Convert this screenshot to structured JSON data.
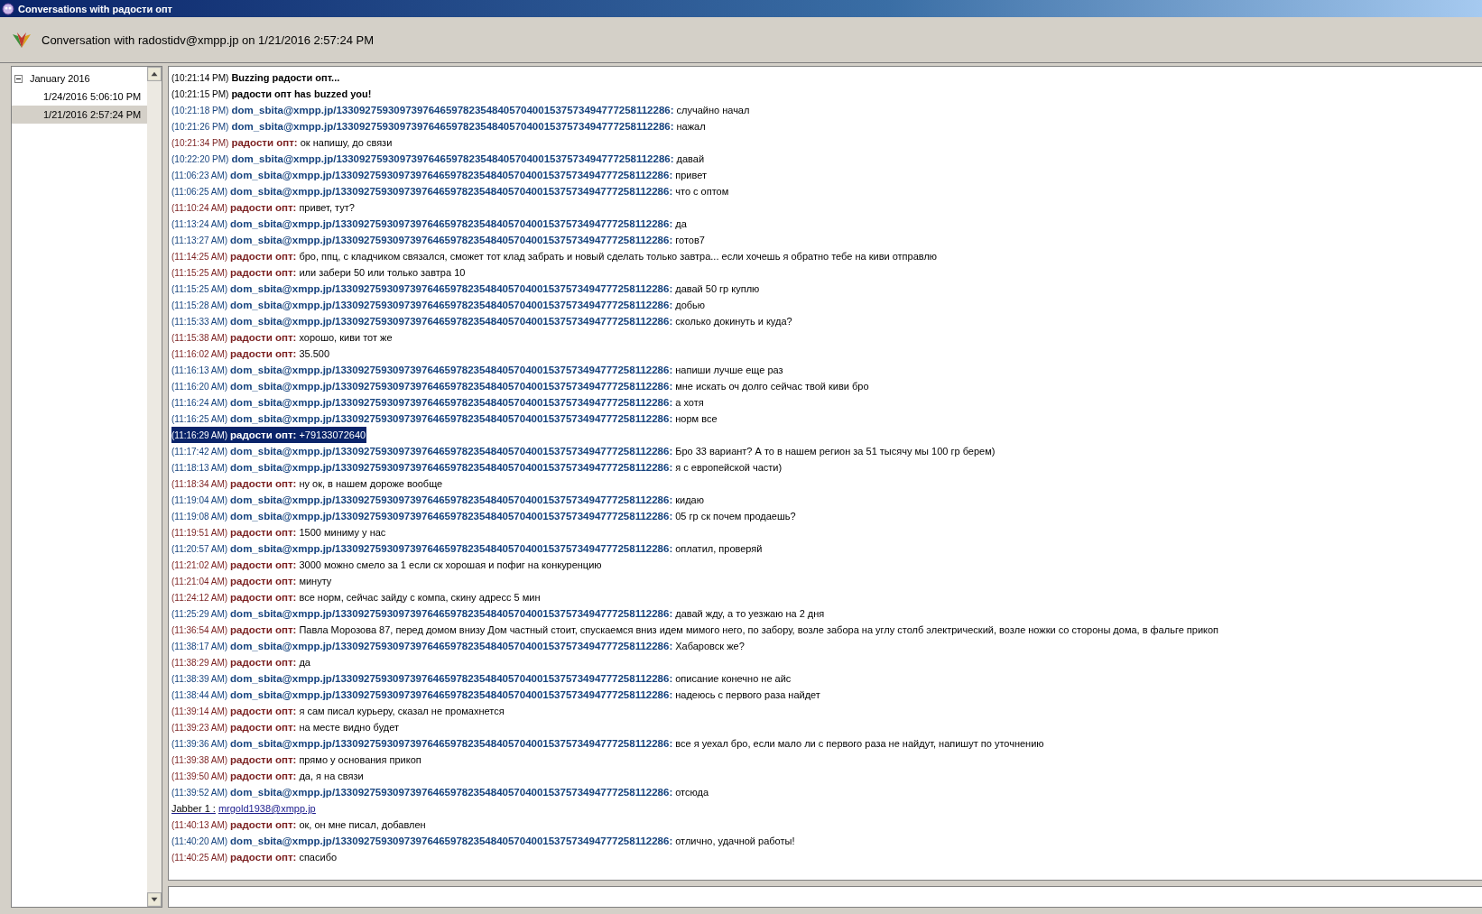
{
  "window": {
    "title": "Conversations with радости опт"
  },
  "header": {
    "title": "Conversation with radostidv@xmpp.jp on 1/21/2016 2:57:24 PM"
  },
  "sidebar": {
    "items": [
      {
        "label": "January 2016",
        "expanded": true,
        "selected": false,
        "children": [
          {
            "label": "1/24/2016 5:06:10 PM",
            "selected": false
          },
          {
            "label": "1/21/2016 2:57:24 PM",
            "selected": true
          }
        ]
      }
    ]
  },
  "messages": [
    {
      "kind": "system",
      "time": "(10:21:14 PM)",
      "text": "Buzzing радости опт...",
      "selected": false
    },
    {
      "kind": "system",
      "time": "(10:21:15 PM)",
      "text": "радости опт has buzzed you!",
      "selected": false
    },
    {
      "kind": "me",
      "time": "(10:21:18 PM)",
      "sender": "dom_sbita@xmpp.jp/1330927593097397646597823548405704001537573494777258112286:",
      "text": "случайно начал",
      "selected": false
    },
    {
      "kind": "me",
      "time": "(10:21:26 PM)",
      "sender": "dom_sbita@xmpp.jp/1330927593097397646597823548405704001537573494777258112286:",
      "text": "нажал",
      "selected": false
    },
    {
      "kind": "them",
      "time": "(10:21:34 PM)",
      "sender": "радости опт:",
      "text": "ок напишу, до связи",
      "selected": false
    },
    {
      "kind": "me",
      "time": "(10:22:20 PM)",
      "sender": "dom_sbita@xmpp.jp/1330927593097397646597823548405704001537573494777258112286:",
      "text": "давай",
      "selected": false
    },
    {
      "kind": "me",
      "time": "(11:06:23 AM)",
      "sender": "dom_sbita@xmpp.jp/1330927593097397646597823548405704001537573494777258112286:",
      "text": "привет",
      "selected": false
    },
    {
      "kind": "me",
      "time": "(11:06:25 AM)",
      "sender": "dom_sbita@xmpp.jp/1330927593097397646597823548405704001537573494777258112286:",
      "text": "что с оптом",
      "selected": false
    },
    {
      "kind": "them",
      "time": "(11:10:24 AM)",
      "sender": "радости опт:",
      "text": "привет, тут?",
      "selected": false
    },
    {
      "kind": "me",
      "time": "(11:13:24 AM)",
      "sender": "dom_sbita@xmpp.jp/1330927593097397646597823548405704001537573494777258112286:",
      "text": "да",
      "selected": false
    },
    {
      "kind": "me",
      "time": "(11:13:27 AM)",
      "sender": "dom_sbita@xmpp.jp/1330927593097397646597823548405704001537573494777258112286:",
      "text": "готов7",
      "selected": false
    },
    {
      "kind": "them",
      "time": "(11:14:25 AM)",
      "sender": "радости опт:",
      "text": "бро, ппц, с кладчиком связался, сможет тот клад забрать и новый сделать только завтра... если хочешь я обратно тебе на киви отправлю",
      "selected": false
    },
    {
      "kind": "them",
      "time": "(11:15:25 AM)",
      "sender": "радости опт:",
      "text": "или забери 50 или только завтра 10",
      "selected": false
    },
    {
      "kind": "me",
      "time": "(11:15:25 AM)",
      "sender": "dom_sbita@xmpp.jp/1330927593097397646597823548405704001537573494777258112286:",
      "text": "давай 50 гр куплю",
      "selected": false
    },
    {
      "kind": "me",
      "time": "(11:15:28 AM)",
      "sender": "dom_sbita@xmpp.jp/1330927593097397646597823548405704001537573494777258112286:",
      "text": "добью",
      "selected": false
    },
    {
      "kind": "me",
      "time": "(11:15:33 AM)",
      "sender": "dom_sbita@xmpp.jp/1330927593097397646597823548405704001537573494777258112286:",
      "text": "сколько докинуть и куда?",
      "selected": false
    },
    {
      "kind": "them",
      "time": "(11:15:38 AM)",
      "sender": "радости опт:",
      "text": "хорошо, киви тот же",
      "selected": false
    },
    {
      "kind": "them",
      "time": "(11:16:02 AM)",
      "sender": "радости опт:",
      "text": "35.500",
      "selected": false
    },
    {
      "kind": "me",
      "time": "(11:16:13 AM)",
      "sender": "dom_sbita@xmpp.jp/1330927593097397646597823548405704001537573494777258112286:",
      "text": "напиши лучше еще раз",
      "selected": false
    },
    {
      "kind": "me",
      "time": "(11:16:20 AM)",
      "sender": "dom_sbita@xmpp.jp/1330927593097397646597823548405704001537573494777258112286:",
      "text": "мне искать оч долго сейчас твой киви бро",
      "selected": false
    },
    {
      "kind": "me",
      "time": "(11:16:24 AM)",
      "sender": "dom_sbita@xmpp.jp/1330927593097397646597823548405704001537573494777258112286:",
      "text": "а хотя",
      "selected": false
    },
    {
      "kind": "me",
      "time": "(11:16:25 AM)",
      "sender": "dom_sbita@xmpp.jp/1330927593097397646597823548405704001537573494777258112286:",
      "text": "норм все",
      "selected": false
    },
    {
      "kind": "them",
      "time": "(11:16:29 AM)",
      "sender": "радости опт:",
      "text": "+79133072640",
      "selected": true
    },
    {
      "kind": "me",
      "time": "(11:17:42 AM)",
      "sender": "dom_sbita@xmpp.jp/1330927593097397646597823548405704001537573494777258112286:",
      "text": "Бро 33 вариант? А то в нашем регион за 51 тысячу мы 100 гр берем)",
      "selected": false
    },
    {
      "kind": "me",
      "time": "(11:18:13 AM)",
      "sender": "dom_sbita@xmpp.jp/1330927593097397646597823548405704001537573494777258112286:",
      "text": "я с европейской части)",
      "selected": false
    },
    {
      "kind": "them",
      "time": "(11:18:34 AM)",
      "sender": "радости опт:",
      "text": "ну ок, в нашем дороже вообще",
      "selected": false
    },
    {
      "kind": "me",
      "time": "(11:19:04 AM)",
      "sender": "dom_sbita@xmpp.jp/1330927593097397646597823548405704001537573494777258112286:",
      "text": "кидаю",
      "selected": false
    },
    {
      "kind": "me",
      "time": "(11:19:08 AM)",
      "sender": "dom_sbita@xmpp.jp/1330927593097397646597823548405704001537573494777258112286:",
      "text": "05 гр ск почем продаешь?",
      "selected": false
    },
    {
      "kind": "them",
      "time": "(11:19:51 AM)",
      "sender": "радости опт:",
      "text": "1500 миниму у нас",
      "selected": false
    },
    {
      "kind": "me",
      "time": "(11:20:57 AM)",
      "sender": "dom_sbita@xmpp.jp/1330927593097397646597823548405704001537573494777258112286:",
      "text": "оплатил, проверяй",
      "selected": false
    },
    {
      "kind": "them",
      "time": "(11:21:02 AM)",
      "sender": "радости опт:",
      "text": "3000 можно смело за 1 если ск хорошая и пофиг на конкуренцию",
      "selected": false
    },
    {
      "kind": "them",
      "time": "(11:21:04 AM)",
      "sender": "радости опт:",
      "text": "минуту",
      "selected": false
    },
    {
      "kind": "them",
      "time": "(11:24:12 AM)",
      "sender": "радости опт:",
      "text": "все норм, сейчас зайду с компа, скину адресс 5 мин",
      "selected": false
    },
    {
      "kind": "me",
      "time": "(11:25:29 AM)",
      "sender": "dom_sbita@xmpp.jp/1330927593097397646597823548405704001537573494777258112286:",
      "text": "давай жду, а то уезжаю на 2 дня",
      "selected": false
    },
    {
      "kind": "them",
      "time": "(11:36:54 AM)",
      "sender": "радости опт:",
      "text": "Павла Морозова 87, перед домом внизу Дом частный стоит, спускаемся вниз идем мимого него, по забору, возле забора на углу столб электрический, возле ножки со стороны дома, в фальге прикоп",
      "selected": false
    },
    {
      "kind": "me",
      "time": "(11:38:17 AM)",
      "sender": "dom_sbita@xmpp.jp/1330927593097397646597823548405704001537573494777258112286:",
      "text": "Хабаровск же?",
      "selected": false
    },
    {
      "kind": "them",
      "time": "(11:38:29 AM)",
      "sender": "радости опт:",
      "text": "да",
      "selected": false
    },
    {
      "kind": "me",
      "time": "(11:38:39 AM)",
      "sender": "dom_sbita@xmpp.jp/1330927593097397646597823548405704001537573494777258112286:",
      "text": "описание конечно не айс",
      "selected": false
    },
    {
      "kind": "me",
      "time": "(11:38:44 AM)",
      "sender": "dom_sbita@xmpp.jp/1330927593097397646597823548405704001537573494777258112286:",
      "text": "надеюсь с первого раза найдет",
      "selected": false
    },
    {
      "kind": "them",
      "time": "(11:39:14 AM)",
      "sender": "радости опт:",
      "text": "я сам писал курьеру, сказал не промахнется",
      "selected": false
    },
    {
      "kind": "them",
      "time": "(11:39:23 AM)",
      "sender": "радости опт:",
      "text": "на месте видно будет",
      "selected": false
    },
    {
      "kind": "me",
      "time": "(11:39:36 AM)",
      "sender": "dom_sbita@xmpp.jp/1330927593097397646597823548405704001537573494777258112286:",
      "text": "все я уехал бро, если мало ли с первого раза не найдут, напишут по уточнению",
      "selected": false
    },
    {
      "kind": "them",
      "time": "(11:39:38 AM)",
      "sender": "радости опт:",
      "text": "прямо у основания прикоп",
      "selected": false
    },
    {
      "kind": "them",
      "time": "(11:39:50 AM)",
      "sender": "радости опт:",
      "text": "да, я на связи",
      "selected": false
    },
    {
      "kind": "me",
      "time": "(11:39:52 AM)",
      "sender": "dom_sbita@xmpp.jp/1330927593097397646597823548405704001537573494777258112286:",
      "text": "отсюда",
      "selected": false
    },
    {
      "kind": "link",
      "text": "Jabber 1 :",
      "link": "mrgold1938@xmpp.jp",
      "selected": false
    },
    {
      "kind": "them",
      "time": "(11:40:13 AM)",
      "sender": "радости опт:",
      "text": "ок, он мне писал, добавлен",
      "selected": false
    },
    {
      "kind": "me",
      "time": "(11:40:20 AM)",
      "sender": "dom_sbita@xmpp.jp/1330927593097397646597823548405704001537573494777258112286:",
      "text": "отлично, удачной работы!",
      "selected": false
    },
    {
      "kind": "them",
      "time": "(11:40:25 AM)",
      "sender": "радости опт:",
      "text": "спасибо",
      "selected": false
    }
  ]
}
